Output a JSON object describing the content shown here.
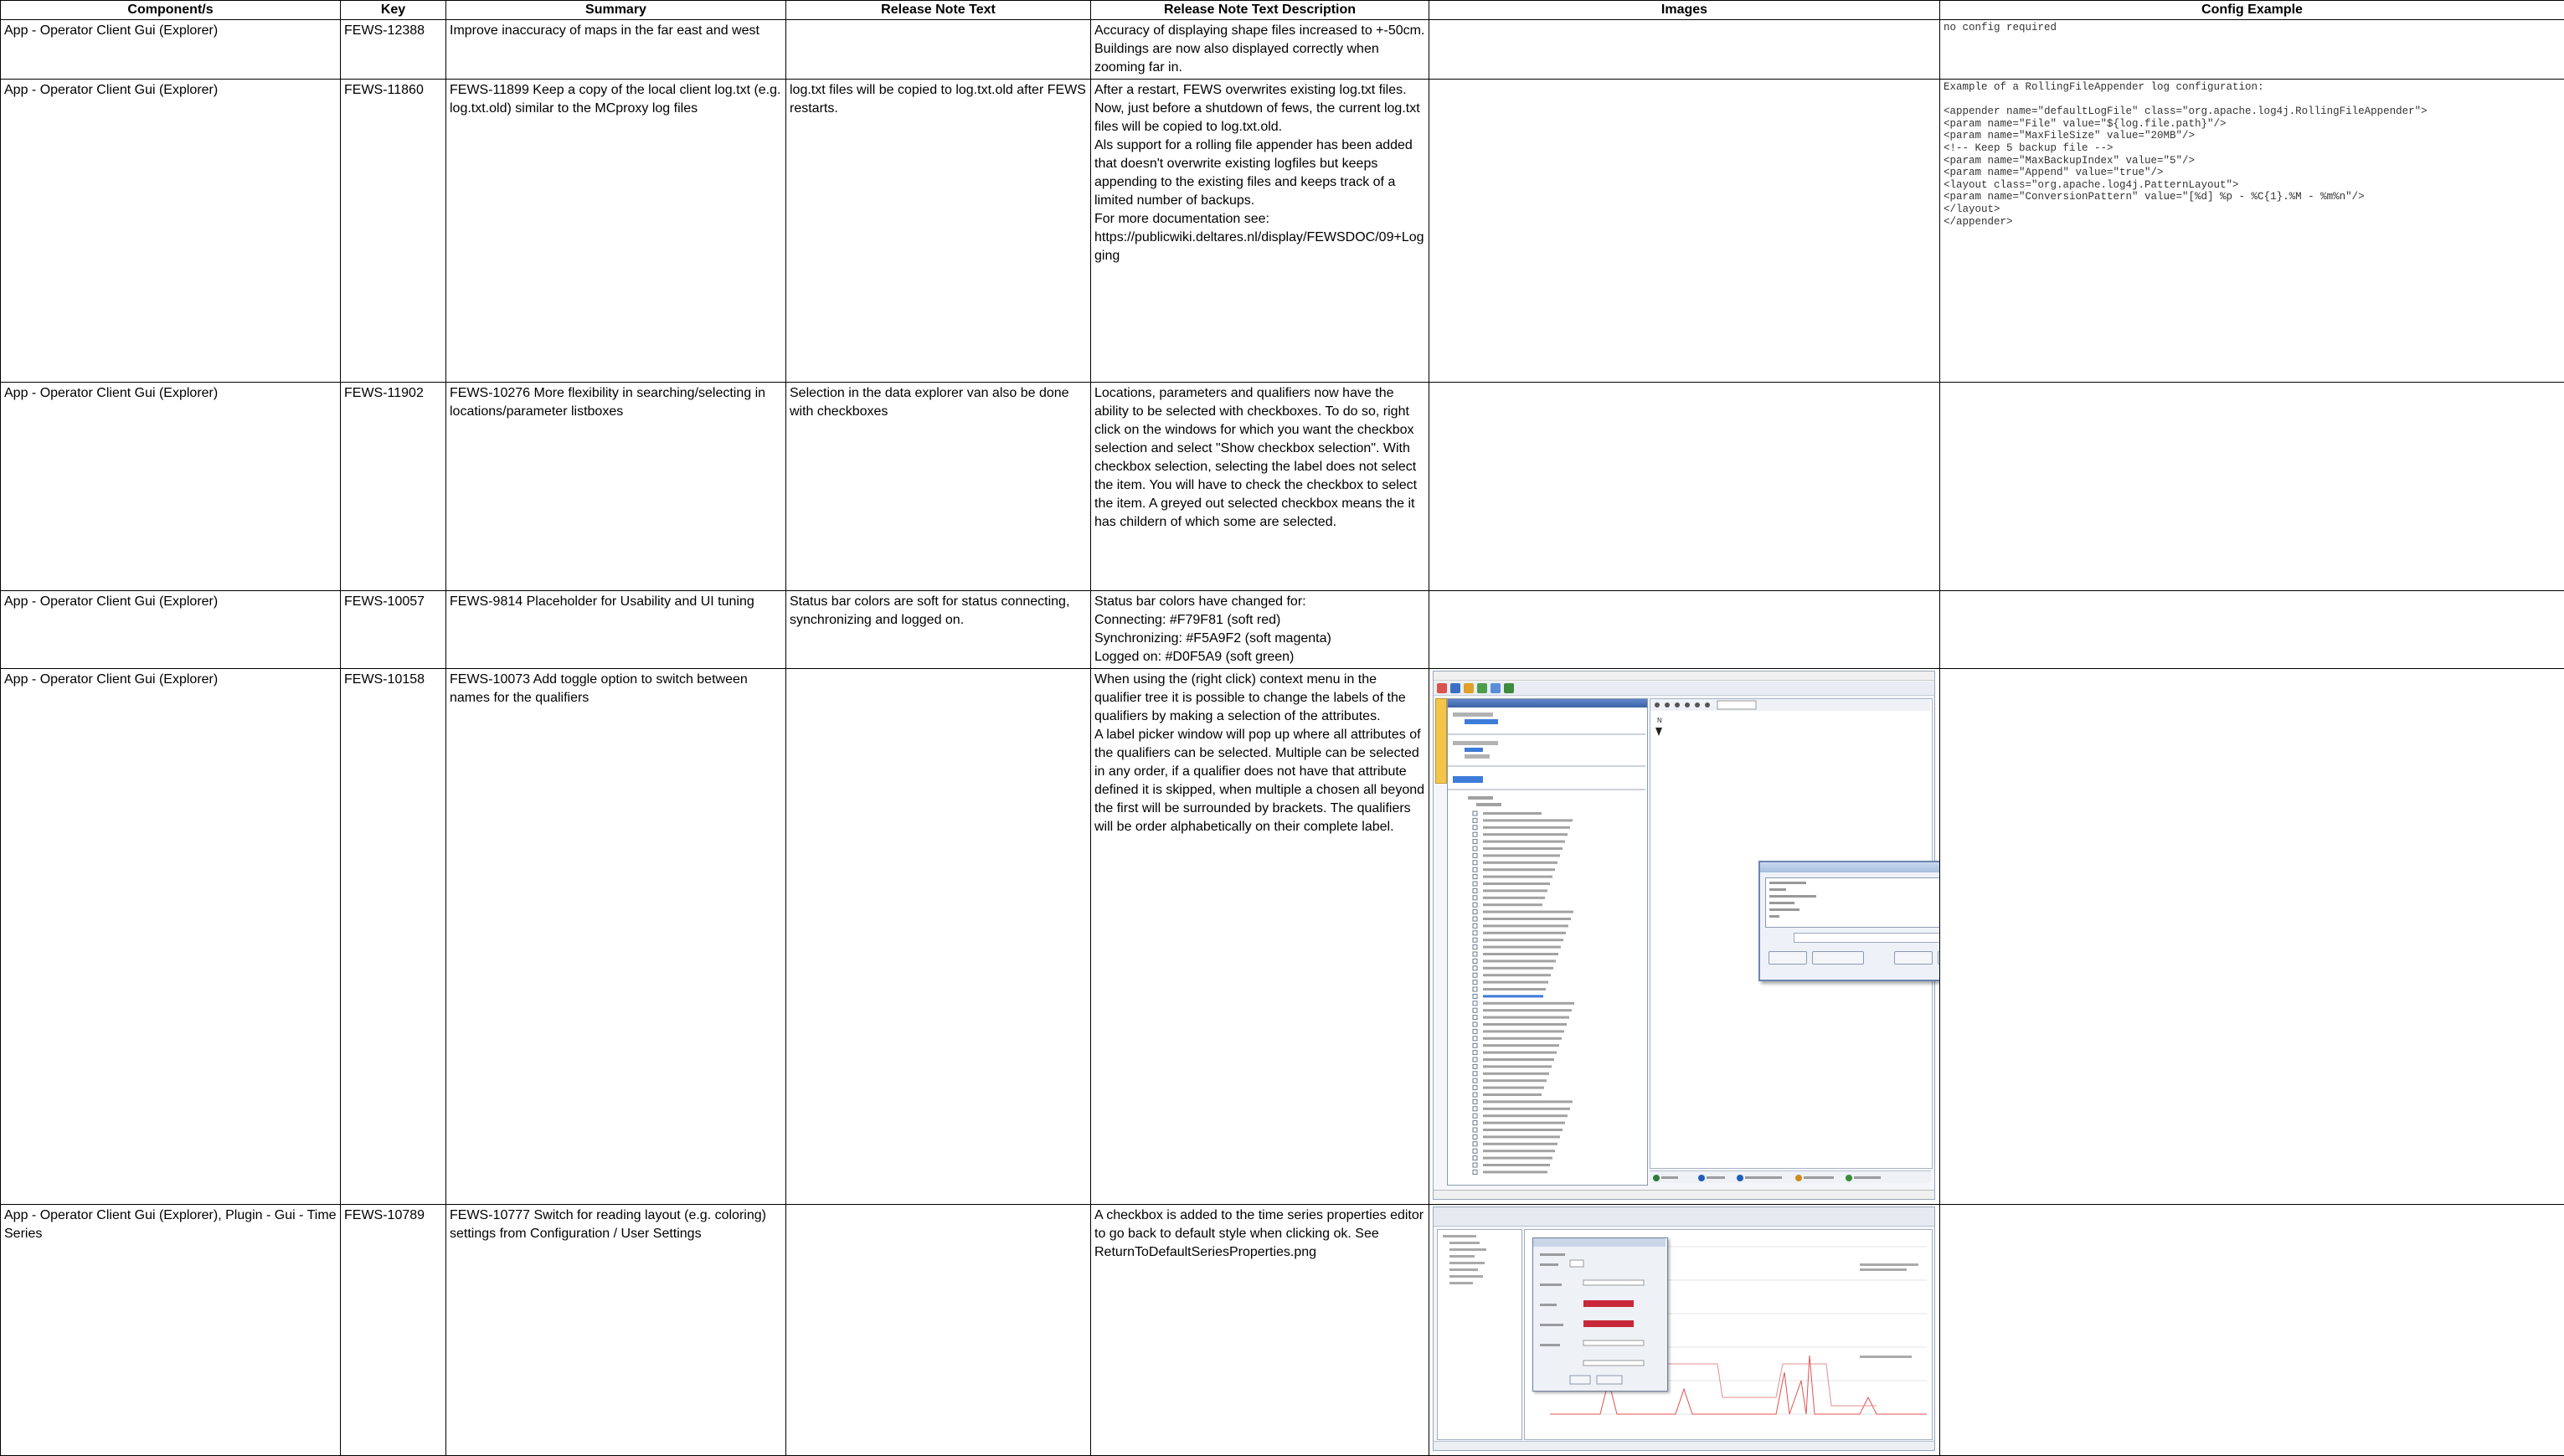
{
  "columns": [
    "Component/s",
    "Key",
    "Summary",
    "Release Note Text",
    "Release Note Text Description",
    "Images",
    "Config Example"
  ],
  "rows": [
    {
      "component": "App - Operator Client Gui (Explorer)",
      "key": "FEWS-12388",
      "summary": "Improve inaccuracy of maps in the far east and west",
      "release_note": "",
      "description": [
        "Accuracy of displaying shape files increased to +-50cm. Buildings are now also displayed correctly when zooming far in."
      ],
      "config": "no config required"
    },
    {
      "component": "App - Operator Client Gui (Explorer)",
      "key": "FEWS-11860",
      "summary": "FEWS-11899 Keep a copy of the local client log.txt (e.g. log.txt.old) similar to the MCproxy log files",
      "release_note": "log.txt files will be copied to log.txt.old after FEWS restarts.",
      "description": [
        "After a restart, FEWS overwrites existing log.txt files. Now, just before a shutdown of fews, the current log.txt files will be copied to log.txt.old.",
        "Als support for a rolling file appender has been added that doesn't overwrite existing logfiles but keeps appending to the existing files and keeps track of a limited number of backups.",
        "For more documentation see:",
        "https://publicwiki.deltares.nl/display/FEWSDOC/09+Logging"
      ],
      "config": "Example of a RollingFileAppender log configuration:\n\n<appender name=\"defaultLogFile\" class=\"org.apache.log4j.RollingFileAppender\">\n<param name=\"File\" value=\"${log.file.path}\"/>\n<param name=\"MaxFileSize\" value=\"20MB\"/>\n<!-- Keep 5 backup file -->\n<param name=\"MaxBackupIndex\" value=\"5\"/>\n<param name=\"Append\" value=\"true\"/>\n<layout class=\"org.apache.log4j.PatternLayout\">\n<param name=\"ConversionPattern\" value=\"[%d] %p - %C{1}.%M - %m%n\"/>\n</layout>\n</appender>"
    },
    {
      "component": "App - Operator Client Gui (Explorer)",
      "key": "FEWS-11902",
      "summary": "FEWS-10276 More flexibility in searching/selecting in locations/parameter listboxes",
      "release_note": "Selection in the data explorer van also be done with checkboxes",
      "description": [
        "Locations, parameters and qualifiers now have the ability to be selected with checkboxes. To do so, right click on the windows for which you want the checkbox selection and select \"Show checkbox selection\". With checkbox selection, selecting the label does not select the item. You will have to check the checkbox to select the item. A greyed out selected checkbox means the it has childern of which some are selected."
      ],
      "config": ""
    },
    {
      "component": "App - Operator Client Gui (Explorer)",
      "key": "FEWS-10057",
      "summary": "FEWS-9814 Placeholder for Usability and UI tuning",
      "release_note": "Status bar colors are soft for status connecting, synchronizing and logged on.",
      "description": [
        "Status bar colors have changed for:",
        "Connecting: #F79F81 (soft red)",
        "Synchronizing: #F5A9F2 (soft magenta)",
        "Logged on: #D0F5A9 (soft green)"
      ],
      "config": ""
    },
    {
      "component": "App - Operator Client Gui (Explorer)",
      "key": "FEWS-10158",
      "summary": "FEWS-10073 Add toggle option to switch between names for the qualifiers",
      "release_note": "",
      "description": [
        "When using the (right click) context menu in the qualifier tree it is possible to change the labels of the qualifiers by making a selection of the attributes.",
        "A label picker window will pop up where all attributes of the qualifiers can be selected. Multiple can be selected in any order, if a qualifier does not have that attribute defined it is skipped, when multiple a chosen all beyond the first will be surrounded by brackets. The qualifiers will be order alphabetically on their complete label."
      ],
      "config": ""
    },
    {
      "component": "App - Operator Client Gui (Explorer), Plugin - Gui - Time Series",
      "key": "FEWS-10789",
      "summary": "FEWS-10777 Switch for reading layout (e.g. coloring) settings from Configuration / User Settings",
      "release_note": "",
      "description": [
        "A checkbox is added to the time series properties editor to go back to default style when clicking ok. See ReturnToDefaultSeriesProperties.png"
      ],
      "config": ""
    }
  ]
}
